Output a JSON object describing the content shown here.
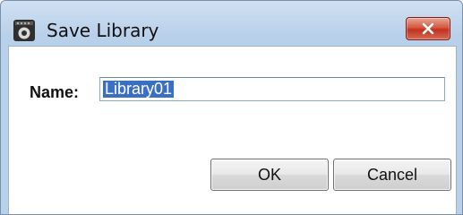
{
  "window": {
    "title": "Save Library",
    "app_icon": "mixer-console-icon",
    "close_icon": "close-icon"
  },
  "form": {
    "name_label": "Name:",
    "name_value": "Library01",
    "name_selected": true
  },
  "buttons": {
    "ok_label": "OK",
    "cancel_label": "Cancel"
  },
  "colors": {
    "titlebar": "#c6daf0",
    "close_button": "#c8412c",
    "selection": "#3b6fc4"
  }
}
